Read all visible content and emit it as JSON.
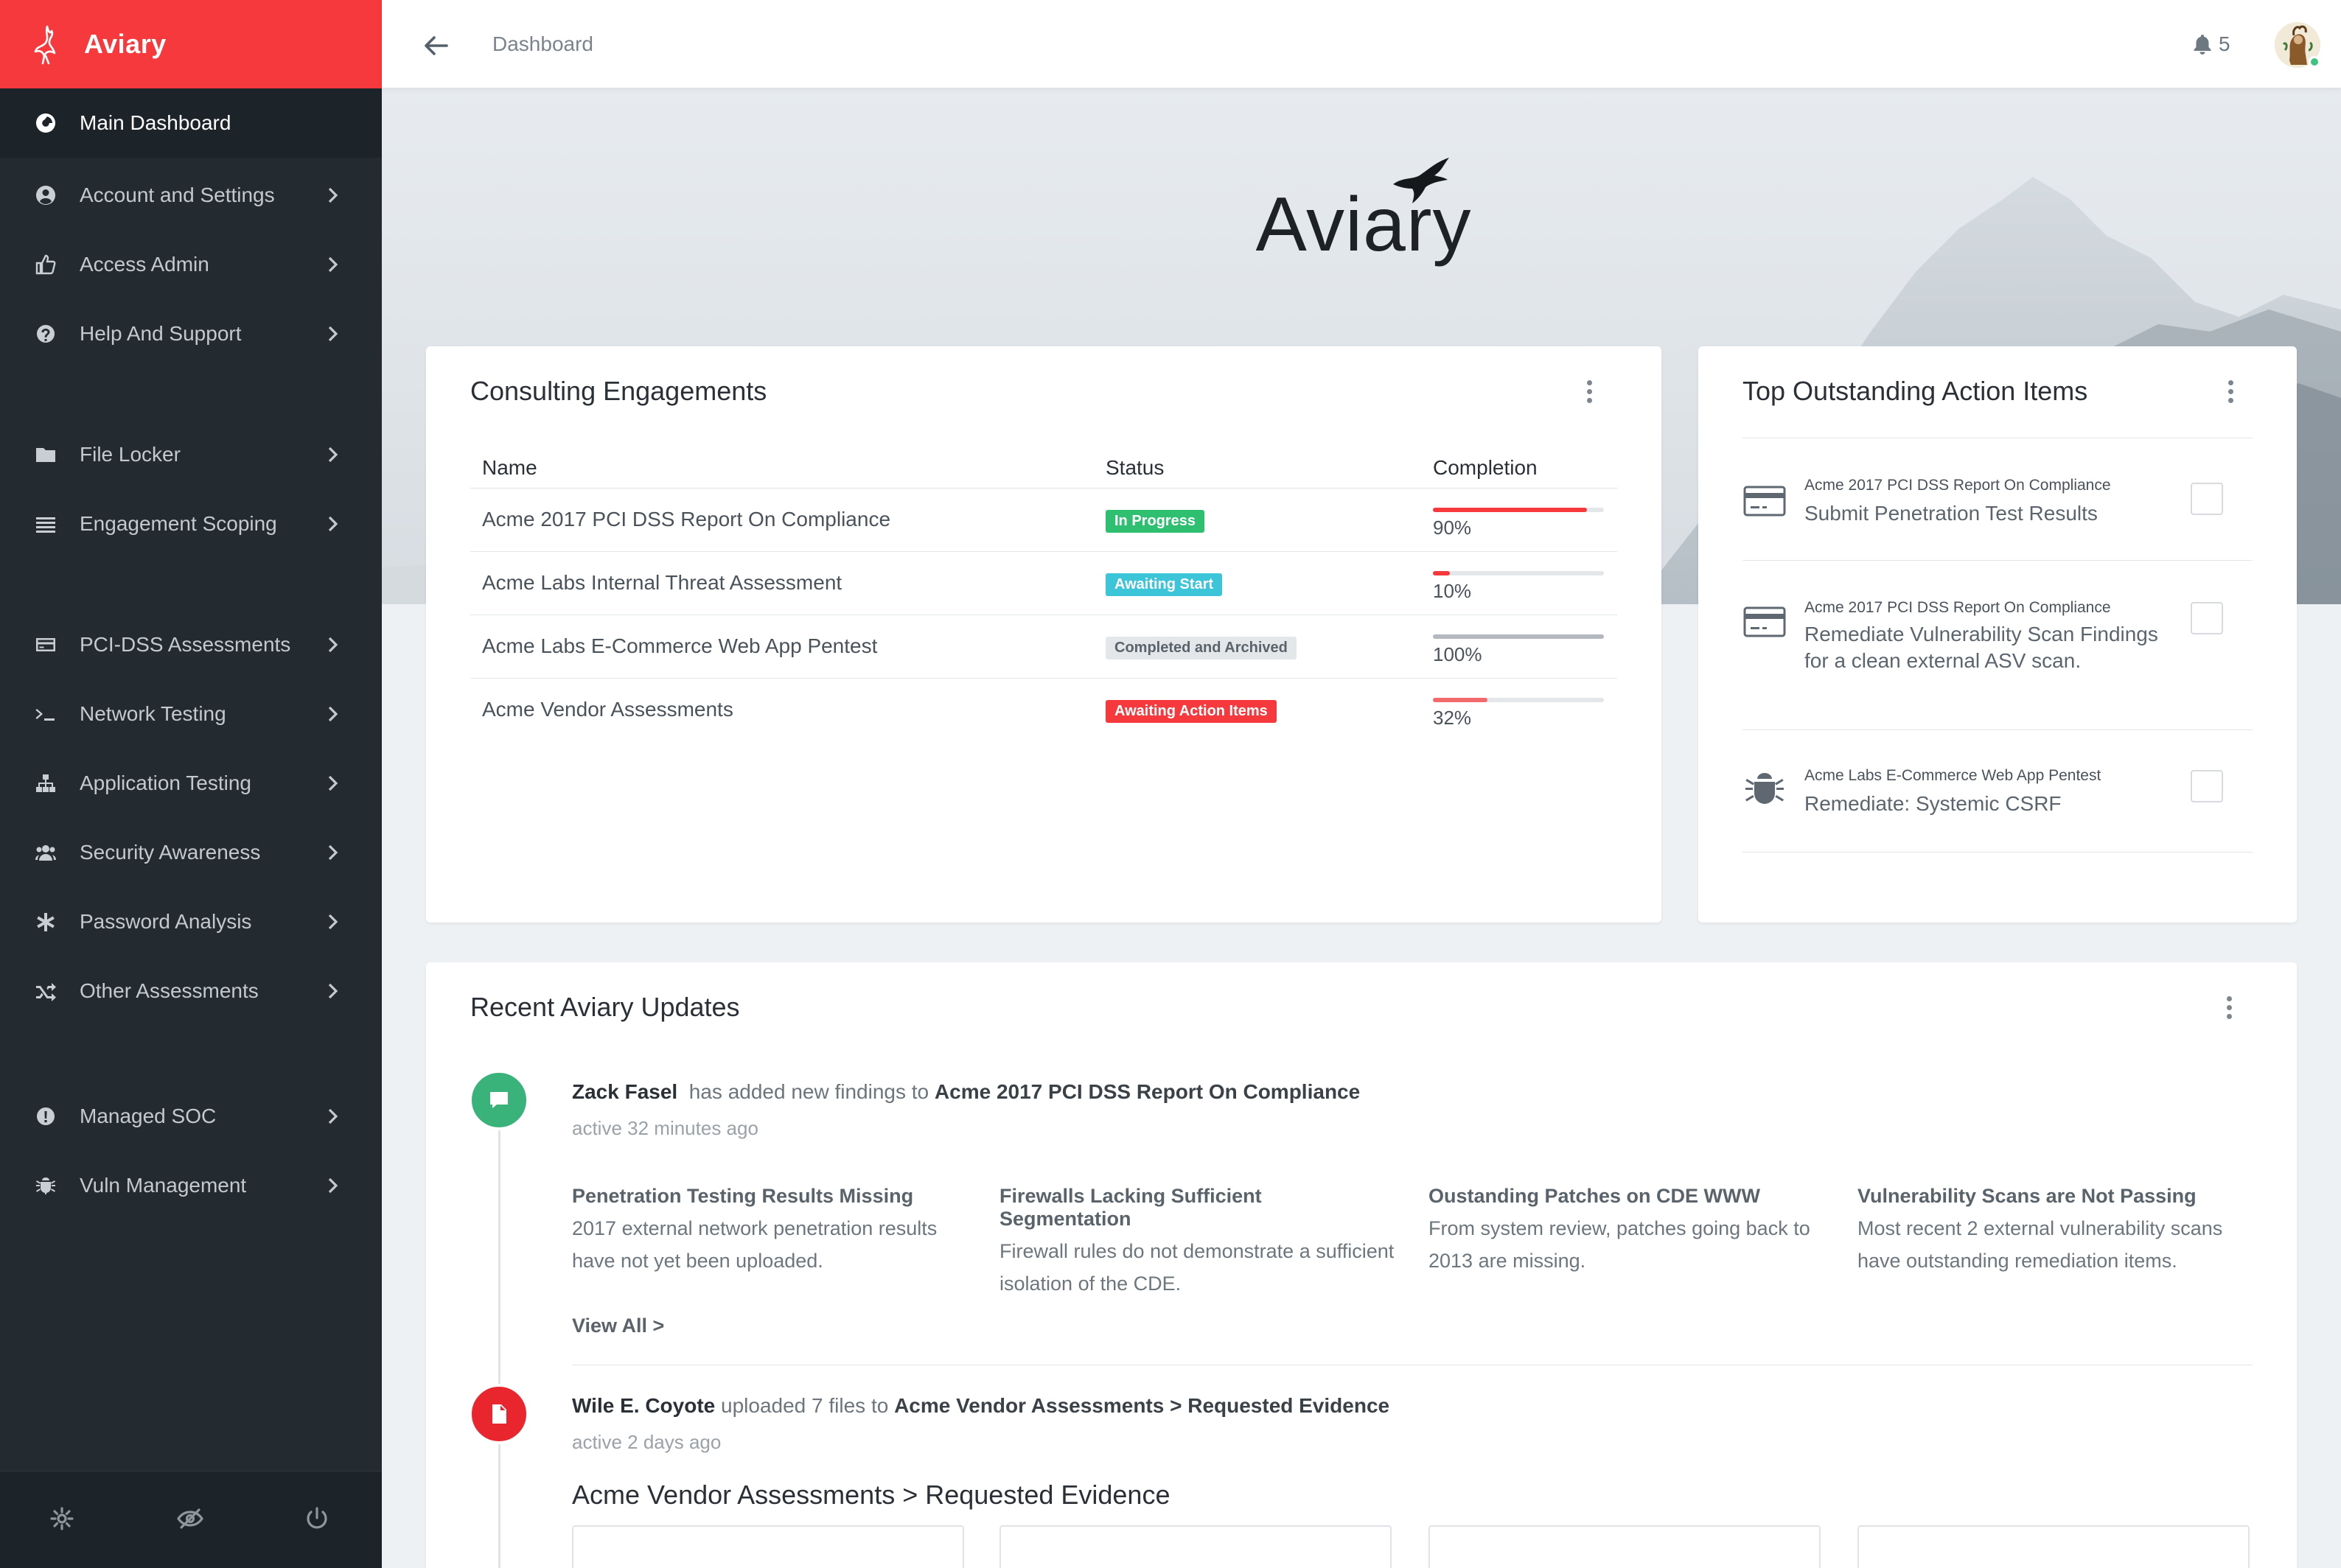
{
  "brand": {
    "name": "Aviary"
  },
  "sidebar": {
    "items": [
      {
        "label": "Main Dashboard",
        "icon": "dashboard-icon",
        "active": true
      },
      {
        "label": "Account and Settings",
        "icon": "user-circle-icon"
      },
      {
        "label": "Access Admin",
        "icon": "thumbs-up-icon"
      },
      {
        "label": "Help And Support",
        "icon": "question-circle-icon"
      },
      {
        "label": "File Locker",
        "icon": "folder-icon"
      },
      {
        "label": "Engagement Scoping",
        "icon": "list-icon"
      },
      {
        "label": "PCI-DSS Assessments",
        "icon": "credit-card-icon"
      },
      {
        "label": "Network Testing",
        "icon": "terminal-icon"
      },
      {
        "label": "Application Testing",
        "icon": "sitemap-icon"
      },
      {
        "label": "Security Awareness",
        "icon": "users-icon"
      },
      {
        "label": "Password Analysis",
        "icon": "asterisk-icon"
      },
      {
        "label": "Other Assessments",
        "icon": "shuffle-icon"
      },
      {
        "label": "Managed SOC",
        "icon": "alert-circle-icon"
      },
      {
        "label": "Vuln Management",
        "icon": "bug-icon"
      }
    ],
    "footer": [
      "gear-icon",
      "eye-slash-icon",
      "power-icon"
    ]
  },
  "header": {
    "breadcrumb": "Dashboard",
    "notifications": "5"
  },
  "hero": {
    "word": "Aviary"
  },
  "engagements": {
    "title": "Consulting Engagements",
    "columns": [
      "Name",
      "Status",
      "Completion"
    ],
    "rows": [
      {
        "name": "Acme 2017 PCI DSS Report On Compliance",
        "status": "In Progress",
        "status_color": "#2fbf71",
        "completion": 90,
        "completion_label": "90%",
        "bar_color": "#f5393c"
      },
      {
        "name": "Acme Labs Internal Threat Assessment",
        "status": "Awaiting Start",
        "status_color": "#3cc4d9",
        "completion": 10,
        "completion_label": "10%",
        "bar_color": "#f5393c"
      },
      {
        "name": "Acme Labs E-Commerce Web App Pentest",
        "status": "Completed and Archived",
        "status_color": "#e4e7ea",
        "status_text_color": "#5a636a",
        "completion": 100,
        "completion_label": "100%",
        "bar_color": "#b3b9be"
      },
      {
        "name": "Acme Vendor Assessments",
        "status": "Awaiting Action Items",
        "status_color": "#f5393c",
        "completion": 32,
        "completion_label": "32%",
        "bar_color": "#f26a6c"
      }
    ]
  },
  "actions": {
    "title": "Top Outstanding Action Items",
    "items": [
      {
        "icon": "credit-card-icon",
        "context": "Acme 2017 PCI DSS Report On Compliance",
        "text": "Submit Penetration Test Results"
      },
      {
        "icon": "credit-card-icon",
        "context": "Acme 2017 PCI DSS Report On Compliance",
        "text": "Remediate Vulnerability Scan Findings for a clean external ASV scan."
      },
      {
        "icon": "bug-icon",
        "context": "Acme Labs E-Commerce Web App Pentest",
        "text": "Remediate: Systemic CSRF"
      }
    ]
  },
  "updates": {
    "title": "Recent Aviary Updates",
    "first": {
      "user": "Zack Fasel",
      "action": "has added new findings to",
      "target": "Acme 2017 PCI DSS Report On Compliance",
      "time": "active 32 minutes ago",
      "dot_color": "#3ab37a",
      "findings": [
        {
          "title": "Penetration Testing Results Missing",
          "desc": "2017 external network penetration results have not yet been uploaded."
        },
        {
          "title": "Firewalls Lacking Sufficient Segmentation",
          "desc": "Firewall rules do not demonstrate a sufficient isolation of the CDE."
        },
        {
          "title": "Oustanding Patches on CDE WWW",
          "desc": "From system review, patches going back to 2013 are missing."
        },
        {
          "title": "Vulnerability Scans are Not Passing",
          "desc": "Most recent 2 external vulnerability scans have outstanding remediation items."
        }
      ],
      "view_all": "View All >"
    },
    "second": {
      "user": "Wile E. Coyote",
      "action": "uploaded 7 files to",
      "target": "Acme Vendor Assessments > Requested Evidence",
      "time": "active 2 days ago",
      "dot_color": "#e9262d",
      "heading": "Acme Vendor Assessments > Requested Evidence"
    }
  }
}
